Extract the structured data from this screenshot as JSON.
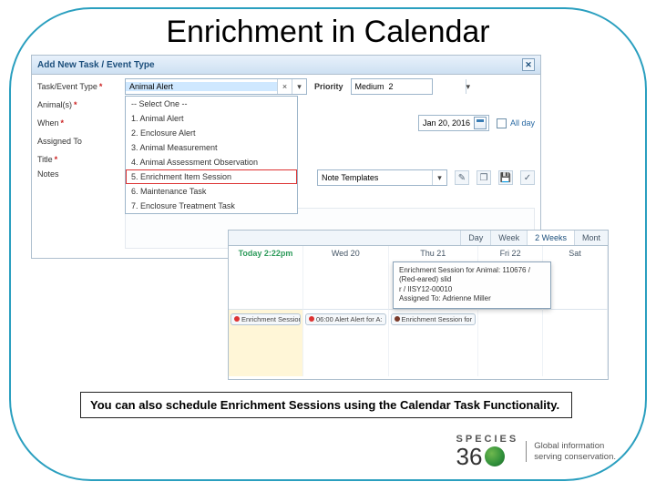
{
  "slide": {
    "title": "Enrichment in Calendar",
    "caption": "You can also schedule Enrichment Sessions using the Calendar Task Functionality."
  },
  "dialog": {
    "title": "Add New Task / Event Type",
    "labels": {
      "type": "Task/Event Type",
      "animals": "Animal(s)",
      "when": "When",
      "assigned": "Assigned To",
      "title_field": "Title",
      "notes": "Notes",
      "priority": "Priority",
      "allday": "All day"
    },
    "values": {
      "type": "Animal Alert",
      "animals_placeholder": "",
      "priority": "Medium  2",
      "end_date": "Jan 20, 2016",
      "note_template": "Note Templates"
    },
    "type_options": [
      "-- Select One --",
      "1. Animal Alert",
      "2. Enclosure Alert",
      "3. Animal Measurement",
      "4. Animal Assessment Observation",
      "5. Enrichment Item Session",
      "6. Maintenance Task",
      "7. Enclosure Treatment Task"
    ]
  },
  "calendar": {
    "tabs": [
      "Day",
      "Week",
      "2 Weeks",
      "Mont"
    ],
    "active_tab": "2 Weeks",
    "today_label": "Today 2:22pm",
    "days": [
      "",
      "Wed 20",
      "Thu 21",
      "Fri 22",
      "Sat"
    ],
    "events": {
      "today": "Enrichment Session fo",
      "wed": "06:00 Alert Alert for A:",
      "thu": "Enrichment Session for"
    },
    "tooltip": {
      "line1": "Enrichment Session for Animal: 110676 / (Red-eared) slid",
      "line2": "r / IISY12-00010",
      "line3": "Assigned To: Adrienne Miller"
    }
  },
  "logo": {
    "species": "SPECIES",
    "three": "3",
    "zero": "0",
    "tagline1": "Global information",
    "tagline2": "serving conservation."
  }
}
